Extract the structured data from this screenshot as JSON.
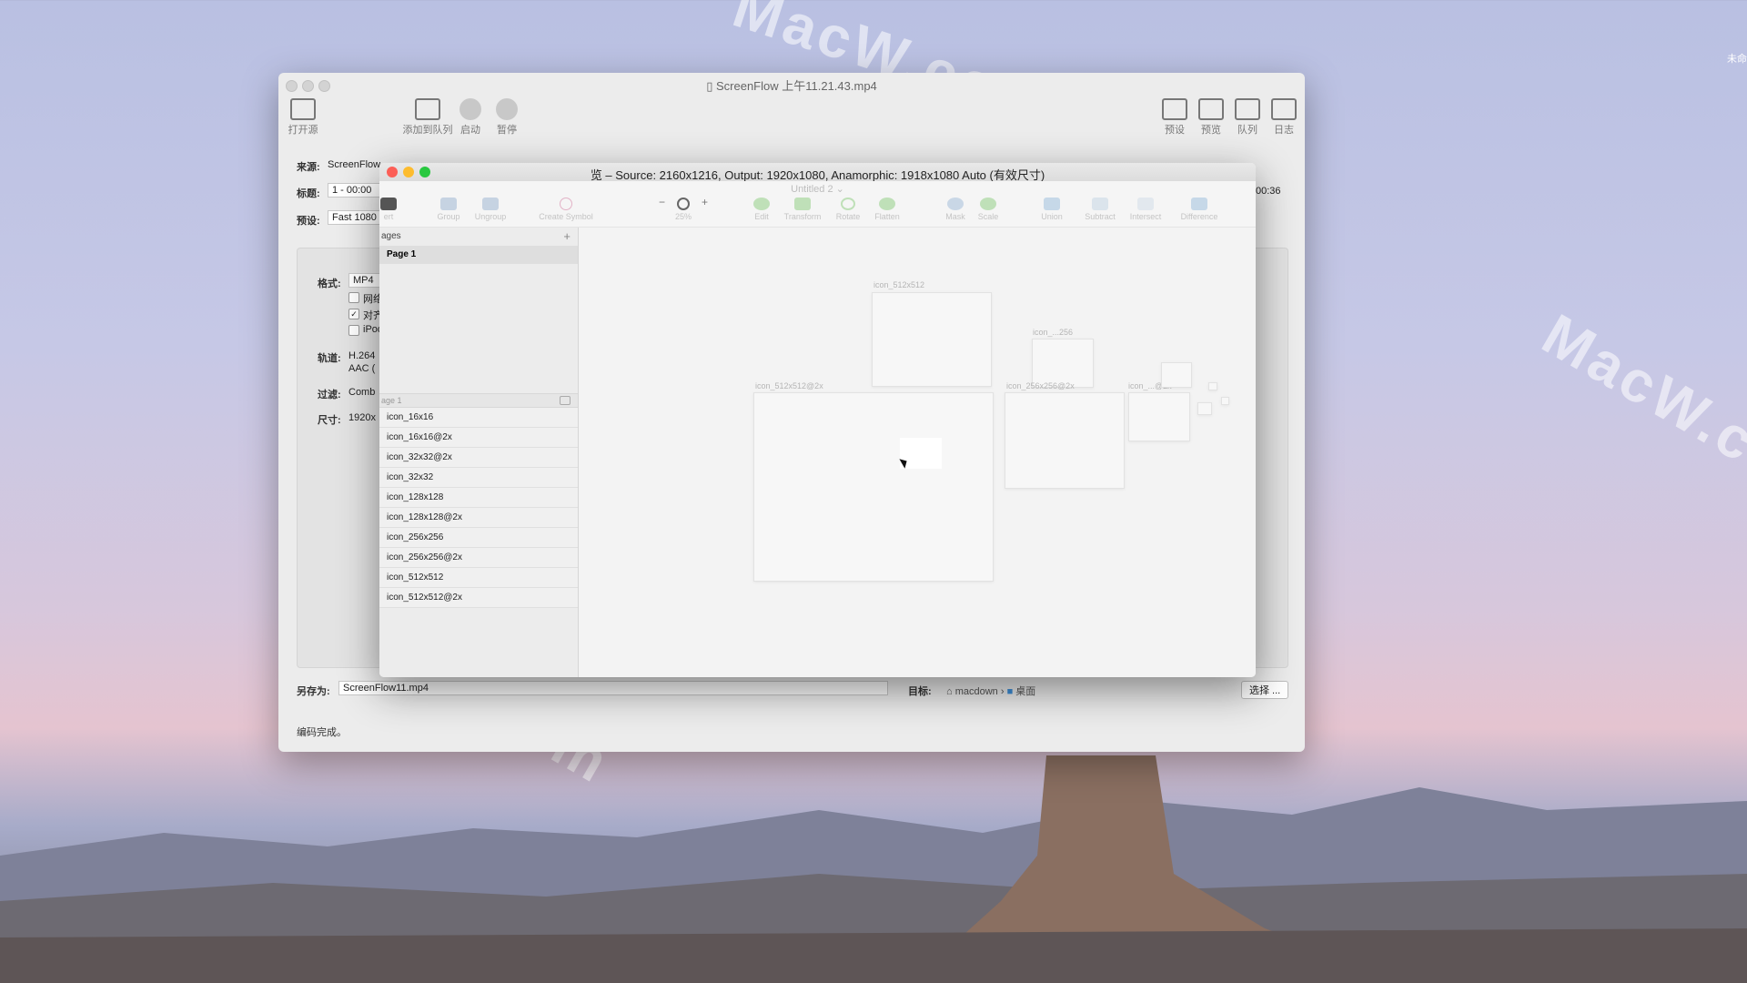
{
  "desktop": {
    "watermarks": [
      "MacW.com",
      "MacW.com",
      "MacW.com"
    ],
    "corner_label": "未命"
  },
  "back_window": {
    "title": "ScreenFlow 上午11.21.43.mp4",
    "toolbar_left": [
      {
        "label": "打开源",
        "icon": "clapper-icon"
      },
      {
        "label": "添加到队列",
        "icon": "add-to-queue-icon"
      },
      {
        "label": "启动",
        "icon": "play-icon"
      },
      {
        "label": "暂停",
        "icon": "pause-icon"
      }
    ],
    "toolbar_right": [
      {
        "label": "预设",
        "icon": "preset-icon"
      },
      {
        "label": "预览",
        "icon": "preview-icon"
      },
      {
        "label": "队列",
        "icon": "queue-icon"
      },
      {
        "label": "日志",
        "icon": "log-icon"
      }
    ],
    "source_label": "来源:",
    "source_value": "ScreenFlow",
    "title_label": "标题:",
    "title_value": "1 - 00:00",
    "duration_tail": "00:36",
    "preset_label": "预设:",
    "preset_value": "Fast 1080",
    "format_label": "格式:",
    "format_value": "MP4",
    "options": [
      {
        "label": "网络",
        "checked": false
      },
      {
        "label": "对齐",
        "checked": true
      },
      {
        "label": "iPod",
        "checked": false
      }
    ],
    "tracks_label": "轨道:",
    "tracks_value_1": "H.264",
    "tracks_value_2": "AAC (",
    "filter_label": "过滤:",
    "filter_value": "Comb",
    "size_label": "尺寸:",
    "size_value": "1920x",
    "saveas_label": "另存为:",
    "saveas_value": "ScreenFlow11.mp4",
    "target_label": "目标:",
    "target_path_home": "macdown",
    "target_path_sep": "›",
    "target_path_folder": "桌面",
    "choose_button": "选择 ...",
    "status": "编码完成。"
  },
  "preview_window": {
    "title": "览 – Source: 2160x1216, Output: 1920x1080, Anamorphic: 1918x1080 Auto (有效尺寸)",
    "doc_title": "Untitled 2 ⌄",
    "tools": [
      {
        "label": "ert"
      },
      {
        "label": "Group"
      },
      {
        "label": "Ungroup"
      },
      {
        "label": "Create Symbol"
      },
      {
        "label": "25%"
      },
      {
        "label": "Edit"
      },
      {
        "label": "Transform"
      },
      {
        "label": "Rotate"
      },
      {
        "label": "Flatten"
      },
      {
        "label": "Mask"
      },
      {
        "label": "Scale"
      },
      {
        "label": "Union"
      },
      {
        "label": "Subtract"
      },
      {
        "label": "Intersect"
      },
      {
        "label": "Difference"
      }
    ],
    "zoom_minus": "−",
    "zoom_plus": "+",
    "pages_header": "ages",
    "pages_add": "+",
    "page_selected": "Page 1",
    "layers_header": "age 1",
    "layers": [
      "icon_16x16",
      "icon_16x16@2x",
      "icon_32x32@2x",
      "icon_32x32",
      "icon_128x128",
      "icon_128x128@2x",
      "icon_256x256",
      "icon_256x256@2x",
      "icon_512x512",
      "icon_512x512@2x"
    ],
    "artboards": {
      "a512": "icon_512x512",
      "a256": "icon_...256",
      "a512x2": "icon_512x512@2x",
      "a256x2": "icon_256x256@2x",
      "asmall": "icon_...@2x"
    }
  }
}
